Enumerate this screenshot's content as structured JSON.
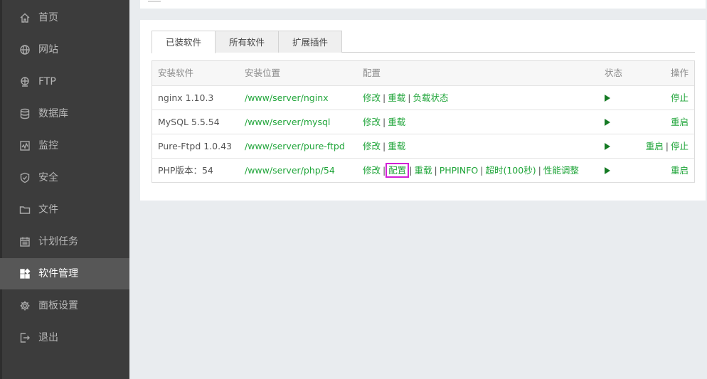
{
  "sidebar": {
    "items": [
      {
        "label": "首页",
        "icon": "home-icon"
      },
      {
        "label": "网站",
        "icon": "globe-icon"
      },
      {
        "label": "FTP",
        "icon": "ftp-icon"
      },
      {
        "label": "数据库",
        "icon": "database-icon"
      },
      {
        "label": "监控",
        "icon": "monitor-icon"
      },
      {
        "label": "安全",
        "icon": "shield-icon"
      },
      {
        "label": "文件",
        "icon": "folder-icon"
      },
      {
        "label": "计划任务",
        "icon": "calendar-icon"
      },
      {
        "label": "软件管理",
        "icon": "apps-icon",
        "active": true
      },
      {
        "label": "面板设置",
        "icon": "gear-icon"
      },
      {
        "label": "退出",
        "icon": "logout-icon"
      }
    ]
  },
  "tabs": [
    {
      "label": "已装软件",
      "active": true
    },
    {
      "label": "所有软件"
    },
    {
      "label": "扩展插件"
    }
  ],
  "table": {
    "headers": {
      "name": "安装软件",
      "path": "安装位置",
      "config": "配置",
      "status": "状态",
      "ops": "操作"
    },
    "rows": [
      {
        "name": "nginx 1.10.3",
        "path": "/www/server/nginx",
        "links": [
          "修改",
          "重载",
          "负载状态"
        ],
        "ops": [
          "停止"
        ]
      },
      {
        "name": "MySQL 5.5.54",
        "path": "/www/server/mysql",
        "links": [
          "修改",
          "重载"
        ],
        "ops": [
          "重启"
        ]
      },
      {
        "name": "Pure-Ftpd 1.0.43",
        "path": "/www/server/pure-ftpd",
        "links": [
          "修改",
          "重载"
        ],
        "ops": [
          "重启",
          "停止"
        ]
      },
      {
        "name": "PHP版本：54",
        "path": "/www/server/php/54",
        "links": [
          "修改",
          "配置",
          "重载",
          "PHPINFO",
          "超时(100秒)",
          "性能调整"
        ],
        "ops": [
          "重启"
        ]
      }
    ]
  },
  "colors": {
    "accent": "#20a53a",
    "sidebar_bg": "#3c3c3c",
    "sidebar_active": "#575757",
    "highlight": "#d21fd6",
    "play": "#157a24"
  }
}
